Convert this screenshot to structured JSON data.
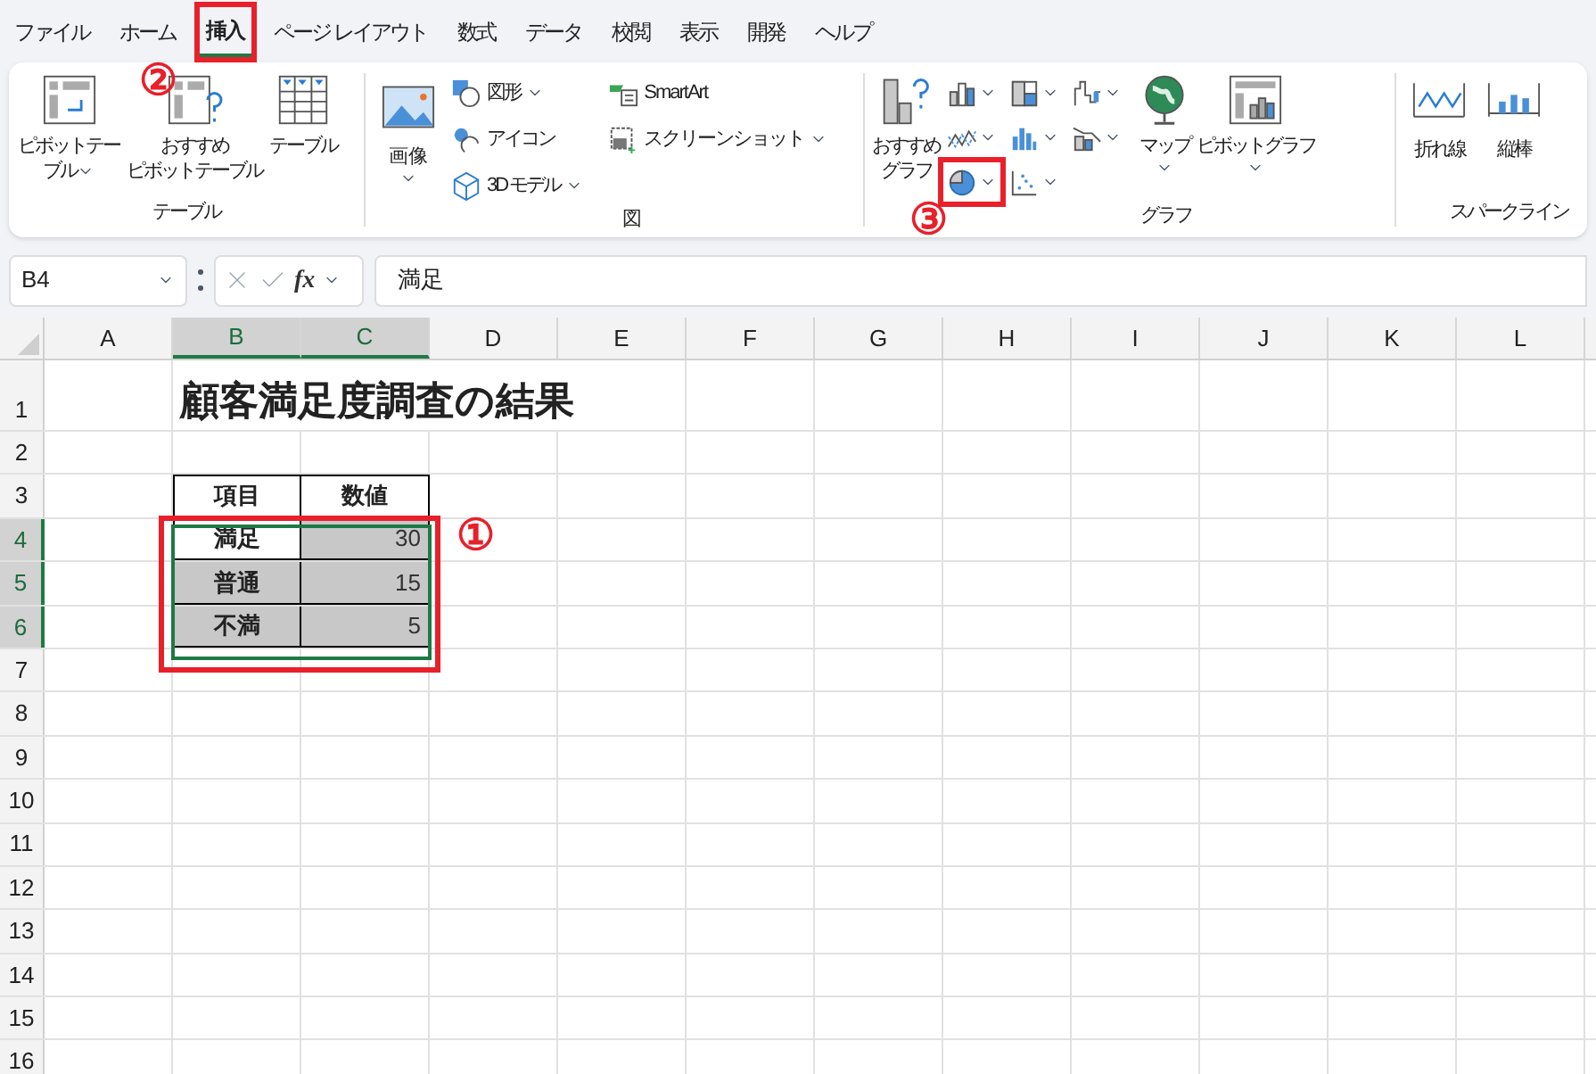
{
  "menu_tabs": [
    {
      "label": "ファイル",
      "selected": false,
      "highlighted": false
    },
    {
      "label": "ホーム",
      "selected": false,
      "highlighted": false
    },
    {
      "label": "挿入",
      "selected": true,
      "highlighted": true
    },
    {
      "label": "ページ レイアウト",
      "selected": false,
      "highlighted": false
    },
    {
      "label": "数式",
      "selected": false,
      "highlighted": false
    },
    {
      "label": "データ",
      "selected": false,
      "highlighted": false
    },
    {
      "label": "校閲",
      "selected": false,
      "highlighted": false
    },
    {
      "label": "表示",
      "selected": false,
      "highlighted": false
    },
    {
      "label": "開発",
      "selected": false,
      "highlighted": false
    },
    {
      "label": "ヘルプ",
      "selected": false,
      "highlighted": false
    }
  ],
  "ribbon": {
    "table_group": {
      "label": "テーブル",
      "buttons": [
        {
          "kind": "pivot",
          "lines": [
            "ピボットテー",
            "ブル"
          ],
          "dropdown": true
        },
        {
          "kind": "recommended_pivot",
          "lines": [
            "おすすめ",
            "ピボットテーブル"
          ],
          "dropdown": false
        },
        {
          "kind": "table",
          "lines": [
            "テーブル"
          ],
          "dropdown": false
        }
      ]
    },
    "illustration_group": {
      "label": "図",
      "image_button": {
        "label": "画像",
        "dropdown": true
      },
      "small_buttons": [
        {
          "kind": "shapes",
          "label": "図形",
          "dropdown": true
        },
        {
          "kind": "icons",
          "label": "アイコン",
          "dropdown": false
        },
        {
          "kind": "model3d",
          "label": "3D モデル",
          "dropdown": true
        }
      ],
      "extra_buttons": [
        {
          "kind": "smartart",
          "label": "SmartArt",
          "dropdown": false
        },
        {
          "kind": "screenshot",
          "label": "スクリーンショット",
          "dropdown": true
        }
      ]
    },
    "chart_group": {
      "label": "グラフ",
      "recommended": {
        "lines": [
          "おすすめ",
          "グラフ"
        ]
      },
      "chart_buttons": [
        {
          "kind": "column",
          "highlighted": false
        },
        {
          "kind": "line",
          "highlighted": false
        },
        {
          "kind": "pie",
          "highlighted": true
        },
        {
          "kind": "hierarchy",
          "highlighted": false
        },
        {
          "kind": "statistic",
          "highlighted": false
        },
        {
          "kind": "scatter",
          "highlighted": false
        },
        {
          "kind": "waterfall",
          "highlighted": false
        },
        {
          "kind": "combo",
          "highlighted": false
        }
      ],
      "map": {
        "label": "マップ",
        "dropdown": true
      },
      "pivot_chart": {
        "label": "ピボットグラフ",
        "dropdown": true
      }
    },
    "sparkline_group": {
      "label": "スパークライン",
      "buttons": [
        {
          "kind": "line",
          "label": "折れ線"
        },
        {
          "kind": "column",
          "label": "縦棒"
        }
      ]
    }
  },
  "formula_bar": {
    "name_box": "B4",
    "function_label": "fx",
    "value": "満足"
  },
  "sheet": {
    "columns": [
      {
        "label": "A",
        "selected": false
      },
      {
        "label": "B",
        "selected": true
      },
      {
        "label": "C",
        "selected": true
      },
      {
        "label": "D",
        "selected": false
      },
      {
        "label": "E",
        "selected": false
      },
      {
        "label": "F",
        "selected": false
      },
      {
        "label": "G",
        "selected": false
      },
      {
        "label": "H",
        "selected": false
      },
      {
        "label": "I",
        "selected": false
      },
      {
        "label": "J",
        "selected": false
      },
      {
        "label": "K",
        "selected": false
      },
      {
        "label": "L",
        "selected": false
      }
    ],
    "rows": [
      {
        "number": "1",
        "selected": false,
        "cells": [
          {
            "kind": "blank",
            "text": ""
          },
          {
            "kind": "title",
            "text": "顧客満足度調査の結果"
          }
        ]
      },
      {
        "number": "2",
        "selected": false,
        "cells": []
      },
      {
        "number": "3",
        "selected": false,
        "cells": [
          {
            "kind": "blank",
            "text": ""
          },
          {
            "kind": "header",
            "text": "項目",
            "selected": false
          },
          {
            "kind": "header",
            "text": "数値",
            "selected": false
          }
        ]
      },
      {
        "number": "4",
        "selected": true,
        "cells": [
          {
            "kind": "blank",
            "text": ""
          },
          {
            "kind": "label",
            "text": "満足",
            "selected": false
          },
          {
            "kind": "number",
            "text": "30",
            "selected": true
          }
        ]
      },
      {
        "number": "5",
        "selected": true,
        "cells": [
          {
            "kind": "blank",
            "text": ""
          },
          {
            "kind": "label",
            "text": "普通",
            "selected": true
          },
          {
            "kind": "number",
            "text": "15",
            "selected": true
          }
        ]
      },
      {
        "number": "6",
        "selected": true,
        "cells": [
          {
            "kind": "blank",
            "text": ""
          },
          {
            "kind": "label",
            "text": "不満",
            "selected": true
          },
          {
            "kind": "number",
            "text": "5",
            "selected": true
          }
        ]
      },
      {
        "number": "7",
        "selected": false,
        "cells": []
      },
      {
        "number": "8",
        "selected": false,
        "cells": []
      },
      {
        "number": "9",
        "selected": false,
        "cells": []
      },
      {
        "number": "10",
        "selected": false,
        "cells": []
      },
      {
        "number": "11",
        "selected": false,
        "cells": []
      },
      {
        "number": "12",
        "selected": false,
        "cells": []
      },
      {
        "number": "13",
        "selected": false,
        "cells": []
      },
      {
        "number": "14",
        "selected": false,
        "cells": []
      },
      {
        "number": "15",
        "selected": false,
        "cells": []
      },
      {
        "number": "16",
        "selected": false,
        "cells": []
      }
    ]
  },
  "annotations": [
    {
      "kind": "tab",
      "label": "②"
    },
    {
      "kind": "chart_button",
      "label": "③"
    },
    {
      "kind": "range",
      "label": "①"
    }
  ]
}
